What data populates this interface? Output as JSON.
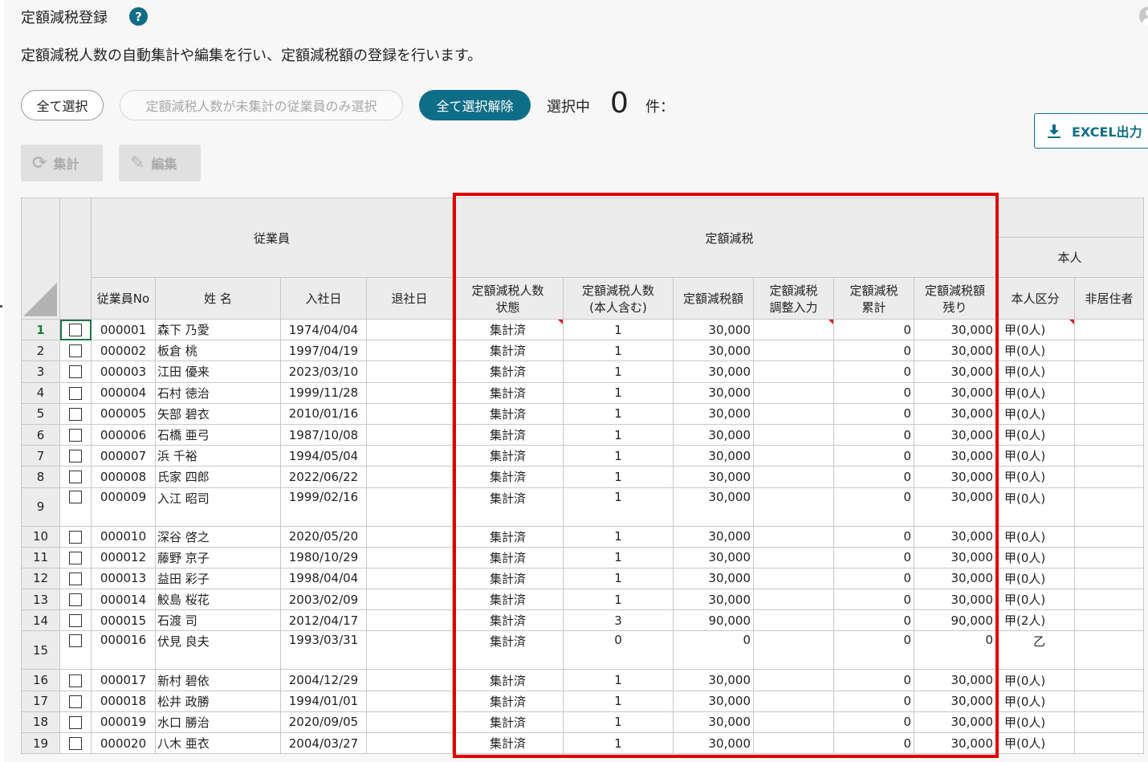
{
  "header": {
    "title": "定額減税登録",
    "help_icon": "?",
    "description": "定額減税人数の自動集計や編集を行い、定額減税額の登録を行います。"
  },
  "selection": {
    "select_all": "全て選択",
    "select_unaggregated": "定額減税人数が未集計の従業員のみ選択",
    "deselect_all": "全て選択解除",
    "selected_label": "選択中",
    "selected_count": "0",
    "selected_unit": "件："
  },
  "toolbar": {
    "aggregate": "集計",
    "edit": "編集",
    "excel": "EXCEL出力"
  },
  "accent_color": "#0f6e87",
  "highlight_color": "#e00000",
  "grid": {
    "group_headers": {
      "employee": "従業員",
      "flat_tax": "定額減税",
      "self": "本人"
    },
    "columns": {
      "emp_no": "従業員No",
      "name": "姓 名",
      "join_date": "入社日",
      "leave_date": "退社日",
      "count_status_1": "定額減税人数",
      "count_status_2": "状態",
      "count_1": "定額減税人数",
      "count_2": "(本人含む)",
      "amount": "定額減税額",
      "adjust_1": "定額減税",
      "adjust_2": "調整入力",
      "cumulative_1": "定額減税",
      "cumulative_2": "累計",
      "remaining_1": "定額減税額",
      "remaining_2": "残り",
      "self_type": "本人区分",
      "nonresident": "非居住者"
    },
    "rows": [
      {
        "n": "1",
        "no": "000001",
        "name": "森下 乃愛",
        "join": "1974/04/04",
        "leave": "",
        "status": "集計済",
        "count": "1",
        "amount": "30,000",
        "adjust": "",
        "cum": "0",
        "remain": "30,000",
        "type": "甲(0人)",
        "nr": ""
      },
      {
        "n": "2",
        "no": "000002",
        "name": "板倉 桃",
        "join": "1997/04/19",
        "leave": "",
        "status": "集計済",
        "count": "1",
        "amount": "30,000",
        "adjust": "",
        "cum": "0",
        "remain": "30,000",
        "type": "甲(0人)",
        "nr": ""
      },
      {
        "n": "3",
        "no": "000003",
        "name": "江田 優来",
        "join": "2023/03/10",
        "leave": "",
        "status": "集計済",
        "count": "1",
        "amount": "30,000",
        "adjust": "",
        "cum": "0",
        "remain": "30,000",
        "type": "甲(0人)",
        "nr": ""
      },
      {
        "n": "4",
        "no": "000004",
        "name": "石村 徳治",
        "join": "1999/11/28",
        "leave": "",
        "status": "集計済",
        "count": "1",
        "amount": "30,000",
        "adjust": "",
        "cum": "0",
        "remain": "30,000",
        "type": "甲(0人)",
        "nr": ""
      },
      {
        "n": "5",
        "no": "000005",
        "name": "矢部 碧衣",
        "join": "2010/01/16",
        "leave": "",
        "status": "集計済",
        "count": "1",
        "amount": "30,000",
        "adjust": "",
        "cum": "0",
        "remain": "30,000",
        "type": "甲(0人)",
        "nr": ""
      },
      {
        "n": "6",
        "no": "000006",
        "name": "石橋 亜弓",
        "join": "1987/10/08",
        "leave": "",
        "status": "集計済",
        "count": "1",
        "amount": "30,000",
        "adjust": "",
        "cum": "0",
        "remain": "30,000",
        "type": "甲(0人)",
        "nr": ""
      },
      {
        "n": "7",
        "no": "000007",
        "name": "浜 千裕",
        "join": "1994/05/04",
        "leave": "",
        "status": "集計済",
        "count": "1",
        "amount": "30,000",
        "adjust": "",
        "cum": "0",
        "remain": "30,000",
        "type": "甲(0人)",
        "nr": ""
      },
      {
        "n": "8",
        "no": "000008",
        "name": "氏家 四郎",
        "join": "2022/06/22",
        "leave": "",
        "status": "集計済",
        "count": "1",
        "amount": "30,000",
        "adjust": "",
        "cum": "0",
        "remain": "30,000",
        "type": "甲(0人)",
        "nr": ""
      },
      {
        "n": "9",
        "no": "000009",
        "name": "入江 昭司",
        "join": "1999/02/16",
        "leave": "",
        "status": "集計済",
        "count": "1",
        "amount": "30,000",
        "adjust": "",
        "cum": "0",
        "remain": "30,000",
        "type": "甲(0人)",
        "nr": ""
      },
      {
        "n": "10",
        "no": "000010",
        "name": "深谷 啓之",
        "join": "2020/05/20",
        "leave": "",
        "status": "集計済",
        "count": "1",
        "amount": "30,000",
        "adjust": "",
        "cum": "0",
        "remain": "30,000",
        "type": "甲(0人)",
        "nr": ""
      },
      {
        "n": "11",
        "no": "000012",
        "name": "藤野 京子",
        "join": "1980/10/29",
        "leave": "",
        "status": "集計済",
        "count": "1",
        "amount": "30,000",
        "adjust": "",
        "cum": "0",
        "remain": "30,000",
        "type": "甲(0人)",
        "nr": ""
      },
      {
        "n": "12",
        "no": "000013",
        "name": "益田 彩子",
        "join": "1998/04/04",
        "leave": "",
        "status": "集計済",
        "count": "1",
        "amount": "30,000",
        "adjust": "",
        "cum": "0",
        "remain": "30,000",
        "type": "甲(0人)",
        "nr": ""
      },
      {
        "n": "13",
        "no": "000014",
        "name": "鮫島 桜花",
        "join": "2003/02/09",
        "leave": "",
        "status": "集計済",
        "count": "1",
        "amount": "30,000",
        "adjust": "",
        "cum": "0",
        "remain": "30,000",
        "type": "甲(0人)",
        "nr": ""
      },
      {
        "n": "14",
        "no": "000015",
        "name": "石渡 司",
        "join": "2012/04/17",
        "leave": "",
        "status": "集計済",
        "count": "3",
        "amount": "90,000",
        "adjust": "",
        "cum": "0",
        "remain": "90,000",
        "type": "甲(2人)",
        "nr": ""
      },
      {
        "n": "15",
        "no": "000016",
        "name": "伏見 良夫",
        "join": "1993/03/31",
        "leave": "",
        "status": "集計済",
        "count": "0",
        "amount": "0",
        "adjust": "",
        "cum": "0",
        "remain": "0",
        "type": "乙",
        "nr": ""
      },
      {
        "n": "16",
        "no": "000017",
        "name": "新村 碧依",
        "join": "2004/12/29",
        "leave": "",
        "status": "集計済",
        "count": "1",
        "amount": "30,000",
        "adjust": "",
        "cum": "0",
        "remain": "30,000",
        "type": "甲(0人)",
        "nr": ""
      },
      {
        "n": "17",
        "no": "000018",
        "name": "松井 政勝",
        "join": "1994/01/01",
        "leave": "",
        "status": "集計済",
        "count": "1",
        "amount": "30,000",
        "adjust": "",
        "cum": "0",
        "remain": "30,000",
        "type": "甲(0人)",
        "nr": ""
      },
      {
        "n": "18",
        "no": "000019",
        "name": "水口 勝治",
        "join": "2020/09/05",
        "leave": "",
        "status": "集計済",
        "count": "1",
        "amount": "30,000",
        "adjust": "",
        "cum": "0",
        "remain": "30,000",
        "type": "甲(0人)",
        "nr": ""
      },
      {
        "n": "19",
        "no": "000020",
        "name": "八木 亜衣",
        "join": "2004/03/27",
        "leave": "",
        "status": "集計済",
        "count": "1",
        "amount": "30,000",
        "adjust": "",
        "cum": "0",
        "remain": "30,000",
        "type": "甲(0人)",
        "nr": ""
      }
    ]
  }
}
